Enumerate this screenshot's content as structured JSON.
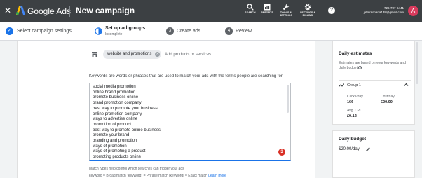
{
  "topbar": {
    "close_icon": "close-icon",
    "brand": "Google Ads",
    "title": "New campaign",
    "tools": [
      {
        "icon": "search-icon",
        "label": "SEARCH"
      },
      {
        "icon": "reports-icon",
        "label": "REPORTS"
      },
      {
        "icon": "tools-icon",
        "label": "TOOLS & SETTINGS"
      },
      {
        "icon": "settings-icon",
        "label": "SETTINGS & BILLING"
      }
    ],
    "help_label": "?",
    "account_id": "726-707-6441",
    "account_email": "jeffersonana138@gmail.com",
    "avatar_letter": "A",
    "colors": {
      "bar": "#3c4043",
      "avatar": "#d93b5d"
    }
  },
  "stepper": {
    "steps": [
      {
        "label": "Select campaign settings",
        "state": "done"
      },
      {
        "label": "Set up ad groups",
        "sub": "Incomplete",
        "state": "current"
      },
      {
        "number": "3",
        "label": "Create ads",
        "state": "todo"
      },
      {
        "number": "4",
        "label": "Review",
        "state": "todo"
      }
    ],
    "colors": {
      "done": "#1a73e8",
      "todo": "#5f6368"
    }
  },
  "products": {
    "chip_label": "website and promotions",
    "placeholder": "Add products or services"
  },
  "keywords": {
    "intro": "Keywords are words or phrases that are used to match your ads with the terms people are searching for",
    "items": [
      "social media promotion",
      "online brand promotion",
      "promote business online",
      "brand promotion company",
      "best way to promote your business",
      "online promotion company",
      "ways to advertise online",
      "promotion of product",
      "best way to promote online business",
      "promote your brand",
      "branding and promotion",
      "ways of promotion",
      "ways of promoting a product",
      "promoting products online"
    ],
    "badge": "3",
    "match_note": "Match types help control which searches can trigger your ads",
    "match_types": "keyword = Broad match  \"keyword\" = Phrase match  [keyword] = Exact match",
    "learn_more": "Learn more"
  },
  "estimates": {
    "title": "Daily estimates",
    "note": "Estimates are based on your keywords and daily budget",
    "group_name": "Group 1",
    "clicks_label": "Clicks/day",
    "clicks_value": "166",
    "cost_label": "Cost/day",
    "cost_value": "£20.00",
    "cpc_label": "Avg. CPC",
    "cpc_value": "£0.12"
  },
  "budget": {
    "title": "Daily budget",
    "value": "£20.00/day"
  }
}
